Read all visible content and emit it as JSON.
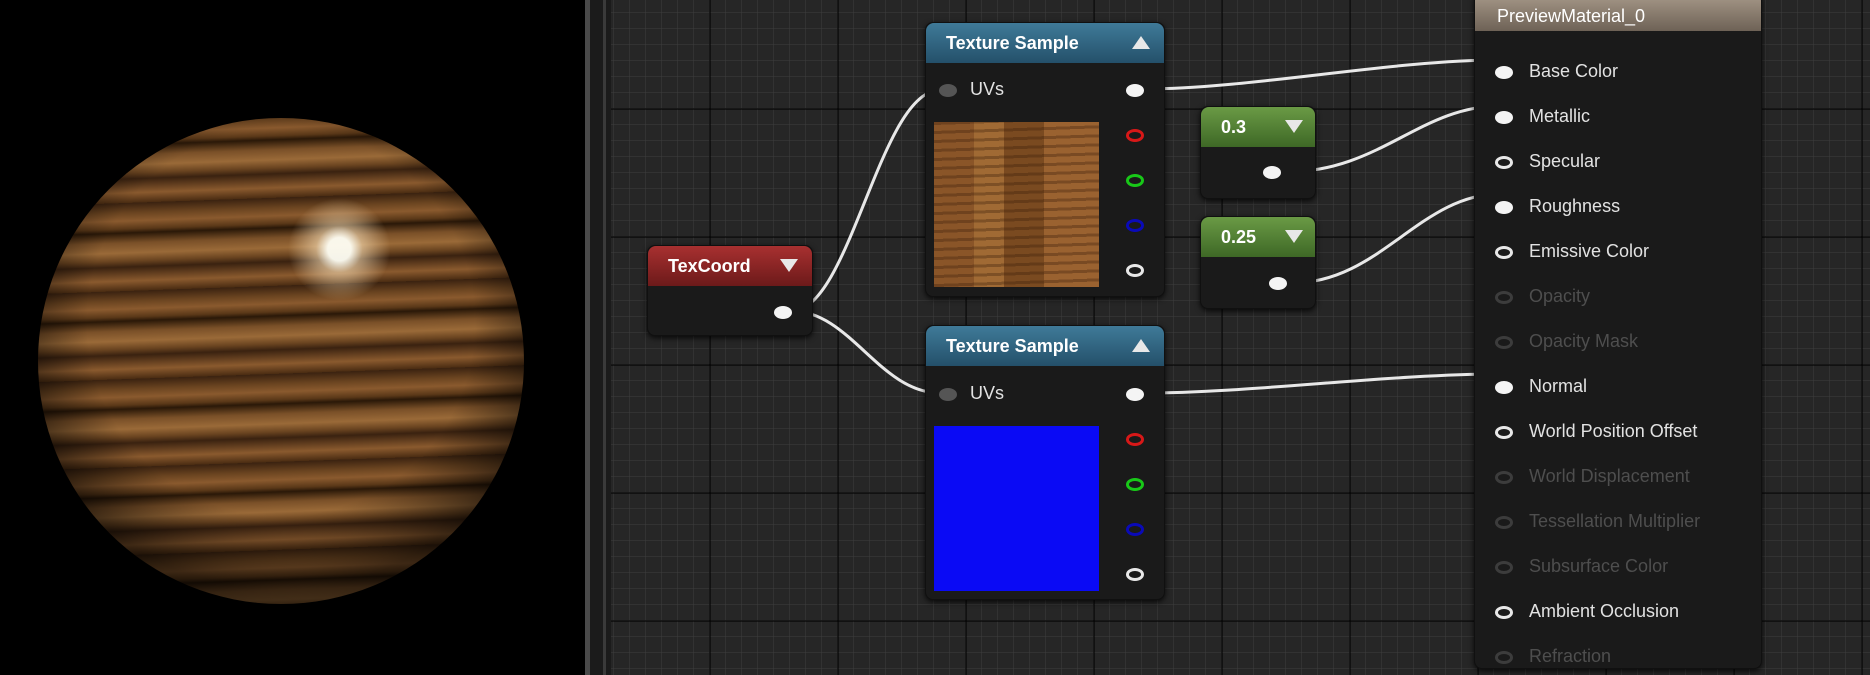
{
  "nodes": {
    "texture_sample_1": {
      "title": "Texture Sample",
      "input_label": "UVs"
    },
    "texture_sample_2": {
      "title": "Texture Sample",
      "input_label": "UVs"
    },
    "texcoord": {
      "title": "TexCoord"
    },
    "constant_1": {
      "title": "0.3"
    },
    "constant_2": {
      "title": "0.25"
    },
    "material": {
      "title": "PreviewMaterial_0",
      "pins": [
        {
          "label": "Base Color",
          "state": "connected"
        },
        {
          "label": "Metallic",
          "state": "connected"
        },
        {
          "label": "Specular",
          "state": "enabled"
        },
        {
          "label": "Roughness",
          "state": "connected"
        },
        {
          "label": "Emissive Color",
          "state": "enabled"
        },
        {
          "label": "Opacity",
          "state": "disabled"
        },
        {
          "label": "Opacity Mask",
          "state": "disabled"
        },
        {
          "label": "Normal",
          "state": "connected"
        },
        {
          "label": "World Position Offset",
          "state": "enabled"
        },
        {
          "label": "World Displacement",
          "state": "disabled"
        },
        {
          "label": "Tessellation Multiplier",
          "state": "disabled"
        },
        {
          "label": "Subsurface Color",
          "state": "disabled"
        },
        {
          "label": "Ambient Occlusion",
          "state": "enabled"
        },
        {
          "label": "Refraction",
          "state": "disabled"
        }
      ]
    }
  },
  "colors": {
    "graph_background": "#262626",
    "texture_header": "#3f7a98",
    "texcoord_header": "#a83030",
    "constant_header": "#6a9a45",
    "material_header": "#a89a8a"
  }
}
